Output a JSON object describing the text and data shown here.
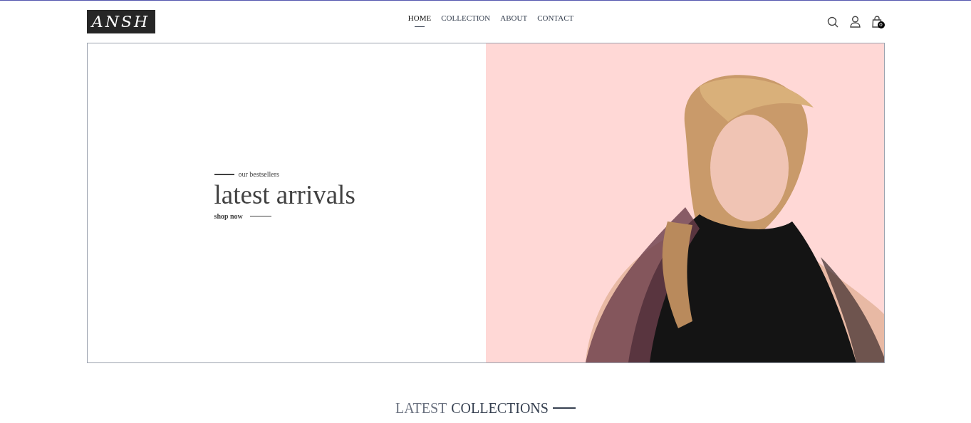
{
  "logo": "ANSH",
  "nav": [
    {
      "label": "HOME",
      "selected": true
    },
    {
      "label": "COLLECTION",
      "selected": false
    },
    {
      "label": "ABOUT",
      "selected": false
    },
    {
      "label": "CONTACT",
      "selected": false
    }
  ],
  "cart": {
    "count": "0"
  },
  "hero": {
    "eyebrow": "our bestsellers",
    "title": "latest arrivals",
    "cta": "shop now"
  },
  "section": {
    "title_light": "LATEST",
    "title_dark": "COLLECTIONS"
  }
}
